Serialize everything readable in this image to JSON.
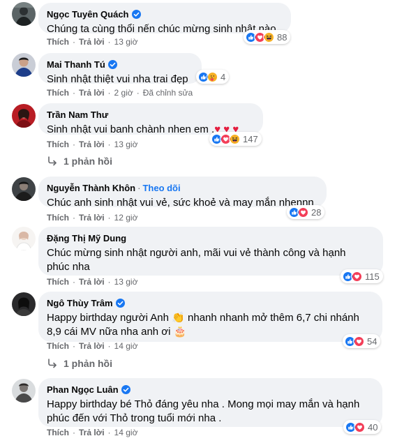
{
  "colors": {
    "like": "#1877f2",
    "love": "#f33e58",
    "haha": "#f7b125",
    "verified": "#1877f2",
    "meta_text": "#65676b",
    "bubble": "#f0f2f5"
  },
  "actions": {
    "like": "Thích",
    "reply": "Trả lời",
    "separator": "·"
  },
  "comments": [
    {
      "name": "Ngọc Tuyên Quách",
      "verified": true,
      "text": "Chúng ta cùng thổi nến chúc mừng sinh nhật nào.",
      "time": "13 giờ",
      "reactions": [
        "like-icon",
        "love-icon",
        "haha-icon"
      ],
      "count": "88"
    },
    {
      "name": "Mai Thanh Tú",
      "verified": true,
      "text": "Sinh nhật thiệt vui nha trai đẹp",
      "time": "2 giờ",
      "edited": "Đã chỉnh sửa",
      "reactions": [
        "like-icon",
        "care-icon"
      ],
      "count": "4"
    },
    {
      "name": "Trần Nam Thư",
      "verified": false,
      "text": "Sinh nhật vui banh chành nhen em .",
      "hearts": "♥ ♥ ♥",
      "time": "13 giờ",
      "reactions": [
        "like-icon",
        "love-icon",
        "haha-icon"
      ],
      "count": "147",
      "replies": "1 phản hồi"
    },
    {
      "name": "Nguyễn Thành Khôn",
      "verified": false,
      "follow": "Theo dõi",
      "text": "Chúc anh sinh nhật vui vẻ, sức khoẻ và may mắn nhennn",
      "time": "12 giờ",
      "reactions": [
        "like-icon",
        "love-icon"
      ],
      "count": "28"
    },
    {
      "name": "Đặng Thị Mỹ Dung",
      "verified": false,
      "text": "Chúc mừng sinh nhật người anh, mãi vui vẻ thành công và hạnh\nphúc nha",
      "time": "13 giờ",
      "reactions": [
        "like-icon",
        "love-icon"
      ],
      "count": "115"
    },
    {
      "name": "Ngô Thùy Trâm",
      "verified": true,
      "text1": "Happy birthday người Anh ",
      "emoji1": "👏",
      "text2": " nhanh nhanh mở thêm 6,7 chi nhánh\n8,9 cái MV nữa nha anh ơi ",
      "emoji2": "🎂",
      "time": "14 giờ",
      "reactions": [
        "like-icon",
        "love-icon"
      ],
      "count": "54",
      "replies": "1 phản hồi"
    },
    {
      "name": "Phan Ngọc Luân",
      "verified": true,
      "text": "Happy birthday bé Thỏ đáng yêu nha . Mong mọi may mắn và hạnh\nphúc đến với Thỏ trong tuổi mới nha .",
      "time": "14 giờ",
      "reactions": [
        "like-icon",
        "love-icon"
      ],
      "count": "40"
    }
  ]
}
